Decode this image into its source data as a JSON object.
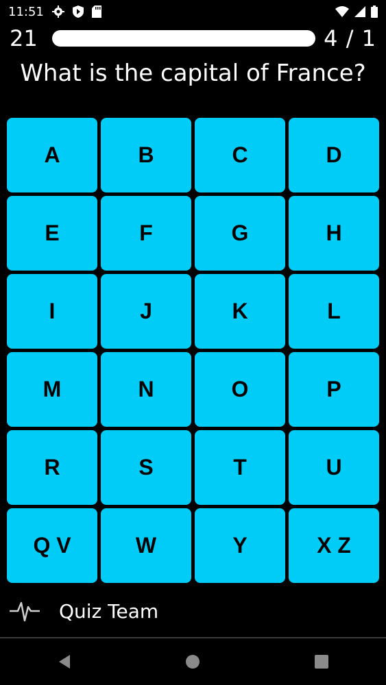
{
  "status": {
    "time": "11:51"
  },
  "header": {
    "score": "21",
    "progress": 1.0,
    "counter": "4 / 1"
  },
  "question": "What is the capital of France?",
  "tiles": [
    "A",
    "B",
    "C",
    "D",
    "E",
    "F",
    "G",
    "H",
    "I",
    "J",
    "K",
    "L",
    "M",
    "N",
    "O",
    "P",
    "R",
    "S",
    "T",
    "U",
    "Q V",
    "W",
    "Y",
    "X Z"
  ],
  "footer": {
    "label": "Quiz Team",
    "icon": "pulse-icon"
  },
  "colors": {
    "tile": "#00cdf7",
    "background": "#000000"
  }
}
